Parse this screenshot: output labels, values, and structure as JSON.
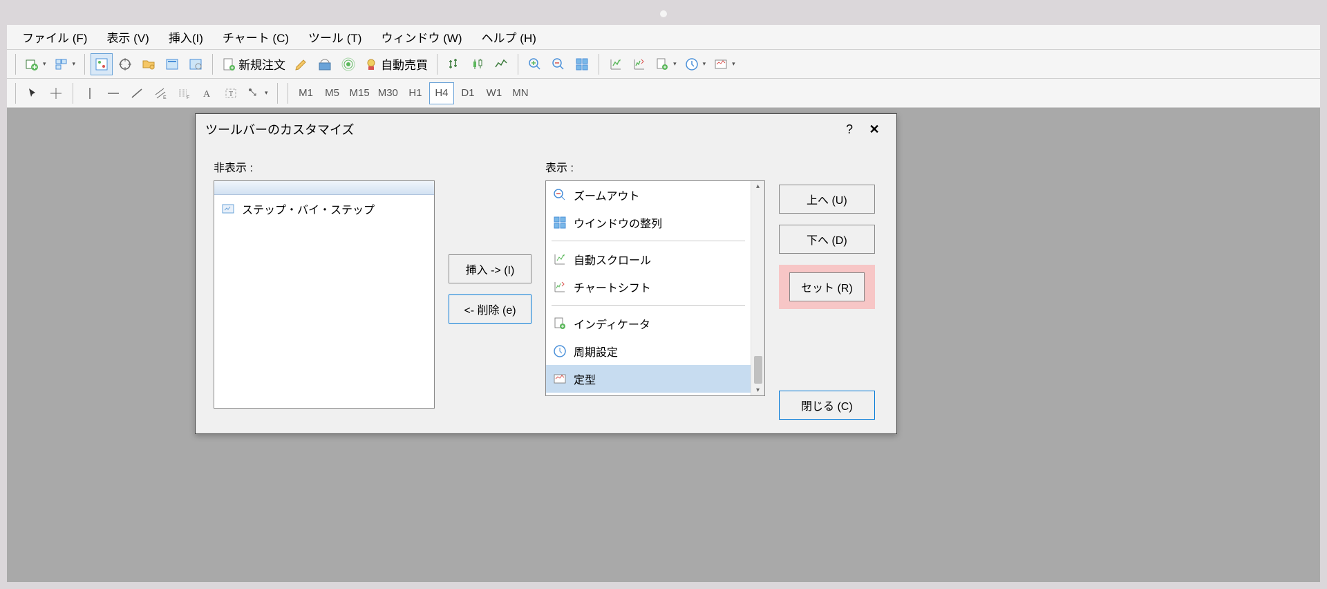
{
  "menubar": {
    "file": "ファイル (F)",
    "view": "表示 (V)",
    "insert": "挿入(I)",
    "chart": "チャート (C)",
    "tool": "ツール (T)",
    "window": "ウィンドウ (W)",
    "help": "ヘルプ (H)"
  },
  "toolbar1": {
    "new_order": "新規注文",
    "auto_trade": "自動売買"
  },
  "toolbar2": {
    "timeframes": [
      "M1",
      "M5",
      "M15",
      "M30",
      "H1",
      "H4",
      "D1",
      "W1",
      "MN"
    ],
    "active_tf": "H4"
  },
  "dialog": {
    "title": "ツールバーのカスタマイズ",
    "help": "?",
    "close": "✕",
    "hidden_label": "非表示 :",
    "visible_label": "表示 :",
    "hidden_items": [
      {
        "label": "ステップ・バイ・ステップ",
        "icon": "step"
      }
    ],
    "visible_items": [
      {
        "label": "ズームアウト",
        "icon": "zoom-out"
      },
      {
        "label": "ウインドウの整列",
        "icon": "arrange"
      },
      {
        "sep": true
      },
      {
        "label": "自動スクロール",
        "icon": "autoscroll"
      },
      {
        "label": "チャートシフト",
        "icon": "chartshift"
      },
      {
        "sep": true
      },
      {
        "label": "インディケータ",
        "icon": "indicator"
      },
      {
        "label": "周期設定",
        "icon": "period"
      },
      {
        "label": "定型",
        "icon": "template",
        "selected": true
      }
    ],
    "insert_btn": "挿入 -> (I)",
    "remove_btn": "<- 削除 (e)",
    "up_btn": "上へ (U)",
    "down_btn": "下へ (D)",
    "reset_btn": "セット (R)",
    "close_btn": "閉じる (C)"
  }
}
